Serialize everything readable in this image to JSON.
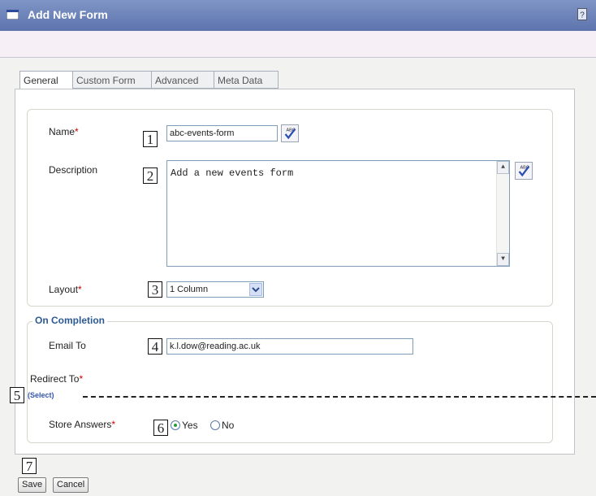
{
  "window": {
    "title": "Add New Form"
  },
  "tabs": [
    {
      "label": "General"
    },
    {
      "label": "Custom Form"
    },
    {
      "label": "Advanced"
    },
    {
      "label": "Meta Data"
    }
  ],
  "fields": {
    "name": {
      "label": "Name",
      "required_mark": "*",
      "value": "abc-events-form"
    },
    "description": {
      "label": "Description",
      "value": "Add a new events form"
    },
    "layout": {
      "label": "Layout",
      "required_mark": "*",
      "selected": "1 Column"
    }
  },
  "completion": {
    "legend": "On Completion",
    "email_to": {
      "label": "Email To",
      "value": "k.l.dow@reading.ac.uk"
    },
    "redirect_to": {
      "label": "Redirect To",
      "required_mark": "*",
      "link": "(Select)"
    },
    "store_answers": {
      "label": "Store Answers",
      "required_mark": "*",
      "yes": "Yes",
      "no": "No",
      "selected": "Yes"
    }
  },
  "buttons": {
    "save": "Save",
    "cancel": "Cancel"
  },
  "callouts": [
    "1",
    "2",
    "3",
    "4",
    "5",
    "6",
    "7"
  ],
  "colors": {
    "titlebar": "#6a80b8",
    "legend": "#2c5a94",
    "required": "#cc0000"
  }
}
